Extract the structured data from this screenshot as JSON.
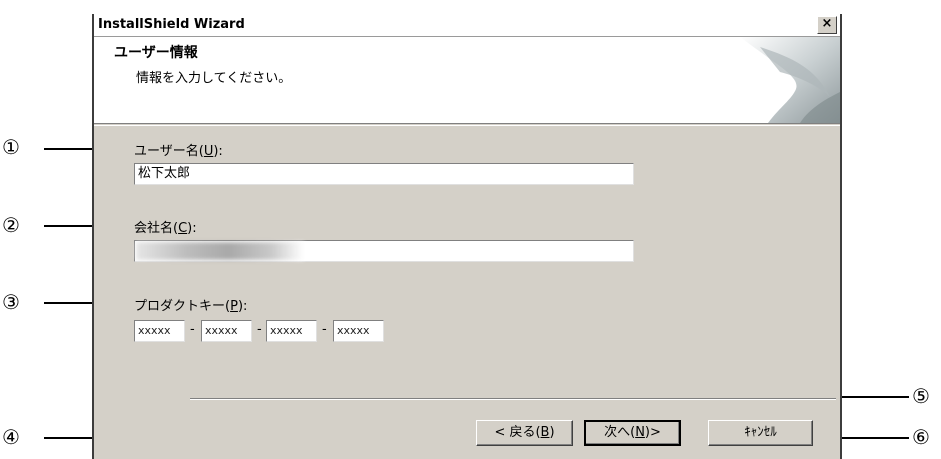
{
  "window": {
    "title": "InstallShield Wizard",
    "close_glyph": "×"
  },
  "header": {
    "title": "ユーザー情報",
    "subtitle": "情報を入力してください。"
  },
  "fields": {
    "user": {
      "label": "ユーザー名",
      "accel_open": "(",
      "accel": "U",
      "accel_close": "):",
      "value": "松下太郎"
    },
    "company": {
      "label": "会社名",
      "accel_open": "(",
      "accel": "C",
      "accel_close": "):",
      "value": ""
    },
    "product_key": {
      "label": "プロダクトキー",
      "accel_open": "(",
      "accel": "P",
      "accel_close": "):",
      "segments": [
        "xxxxx",
        "xxxxx",
        "xxxxx",
        "xxxxx"
      ],
      "dash": "-"
    }
  },
  "buttons": {
    "back": {
      "label": "< 戻る(",
      "accel": "B",
      "tail": ")"
    },
    "next": {
      "label": "次へ(",
      "accel": "N",
      "tail": ")>"
    },
    "cancel": {
      "label": "ｷｬﾝｾﾙ"
    }
  },
  "callouts": [
    "①",
    "②",
    "③",
    "④",
    "⑤",
    "⑥"
  ]
}
